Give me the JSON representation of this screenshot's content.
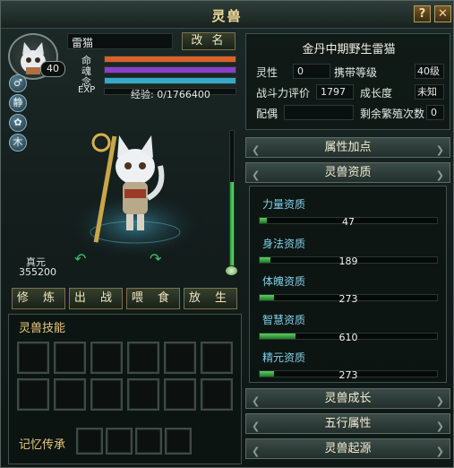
{
  "window": {
    "title": "灵兽",
    "help_label": "?",
    "close_label": "✕"
  },
  "pet": {
    "name": "雷猫",
    "rename_label": "改 名",
    "level": "40",
    "bars": [
      {
        "label": "命",
        "color": "#d9622a",
        "fill": 1.0
      },
      {
        "label": "魂",
        "color": "#8a3fc9",
        "fill": 1.0
      },
      {
        "label": "念",
        "color": "#35a9c8",
        "fill": 1.0
      },
      {
        "label": "EXP",
        "color": "#3a3a3a",
        "fill": 0.0
      }
    ],
    "exp_text": "经验: 0/1766400",
    "side_icons": [
      {
        "name": "male-icon",
        "glyph": "♂"
      },
      {
        "name": "static-icon",
        "glyph": "静"
      },
      {
        "name": "paw-icon",
        "glyph": "✿"
      },
      {
        "name": "wood-icon",
        "glyph": "木"
      }
    ],
    "zhenyuan_label": "真元",
    "zhenyuan_value": "355200"
  },
  "actions": {
    "cultivate": "修 炼",
    "fight": "出 战",
    "feed": "喂 食",
    "release": "放 生"
  },
  "skills": {
    "title": "灵兽技能",
    "memory_label": "记忆传承"
  },
  "info": {
    "title": "金丹中期野生雷猫",
    "rows": [
      {
        "k1": "灵性",
        "v1": "0",
        "k2": "携带等级",
        "v2": "40级"
      },
      {
        "k1": "战斗力评价",
        "v1": "1797",
        "k2": "成长度",
        "v2": "未知"
      },
      {
        "k1": "配偶",
        "v1": "",
        "k2": "剩余繁殖次数",
        "v2": "0"
      }
    ]
  },
  "sections": {
    "attr": "属性加点",
    "aptitude": "灵兽资质",
    "growth": "灵兽成长",
    "five": "五行属性",
    "origin": "灵兽起源"
  },
  "aptitudes": [
    {
      "label": "力量资质",
      "value": "47",
      "fill": 0.04
    },
    {
      "label": "身法资质",
      "value": "189",
      "fill": 0.06
    },
    {
      "label": "体魄资质",
      "value": "273",
      "fill": 0.08
    },
    {
      "label": "智慧资质",
      "value": "610",
      "fill": 0.2
    },
    {
      "label": "精元资质",
      "value": "273",
      "fill": 0.08
    }
  ],
  "colors": {
    "accent": "#e8c97a",
    "green": "#3fbf4a"
  }
}
